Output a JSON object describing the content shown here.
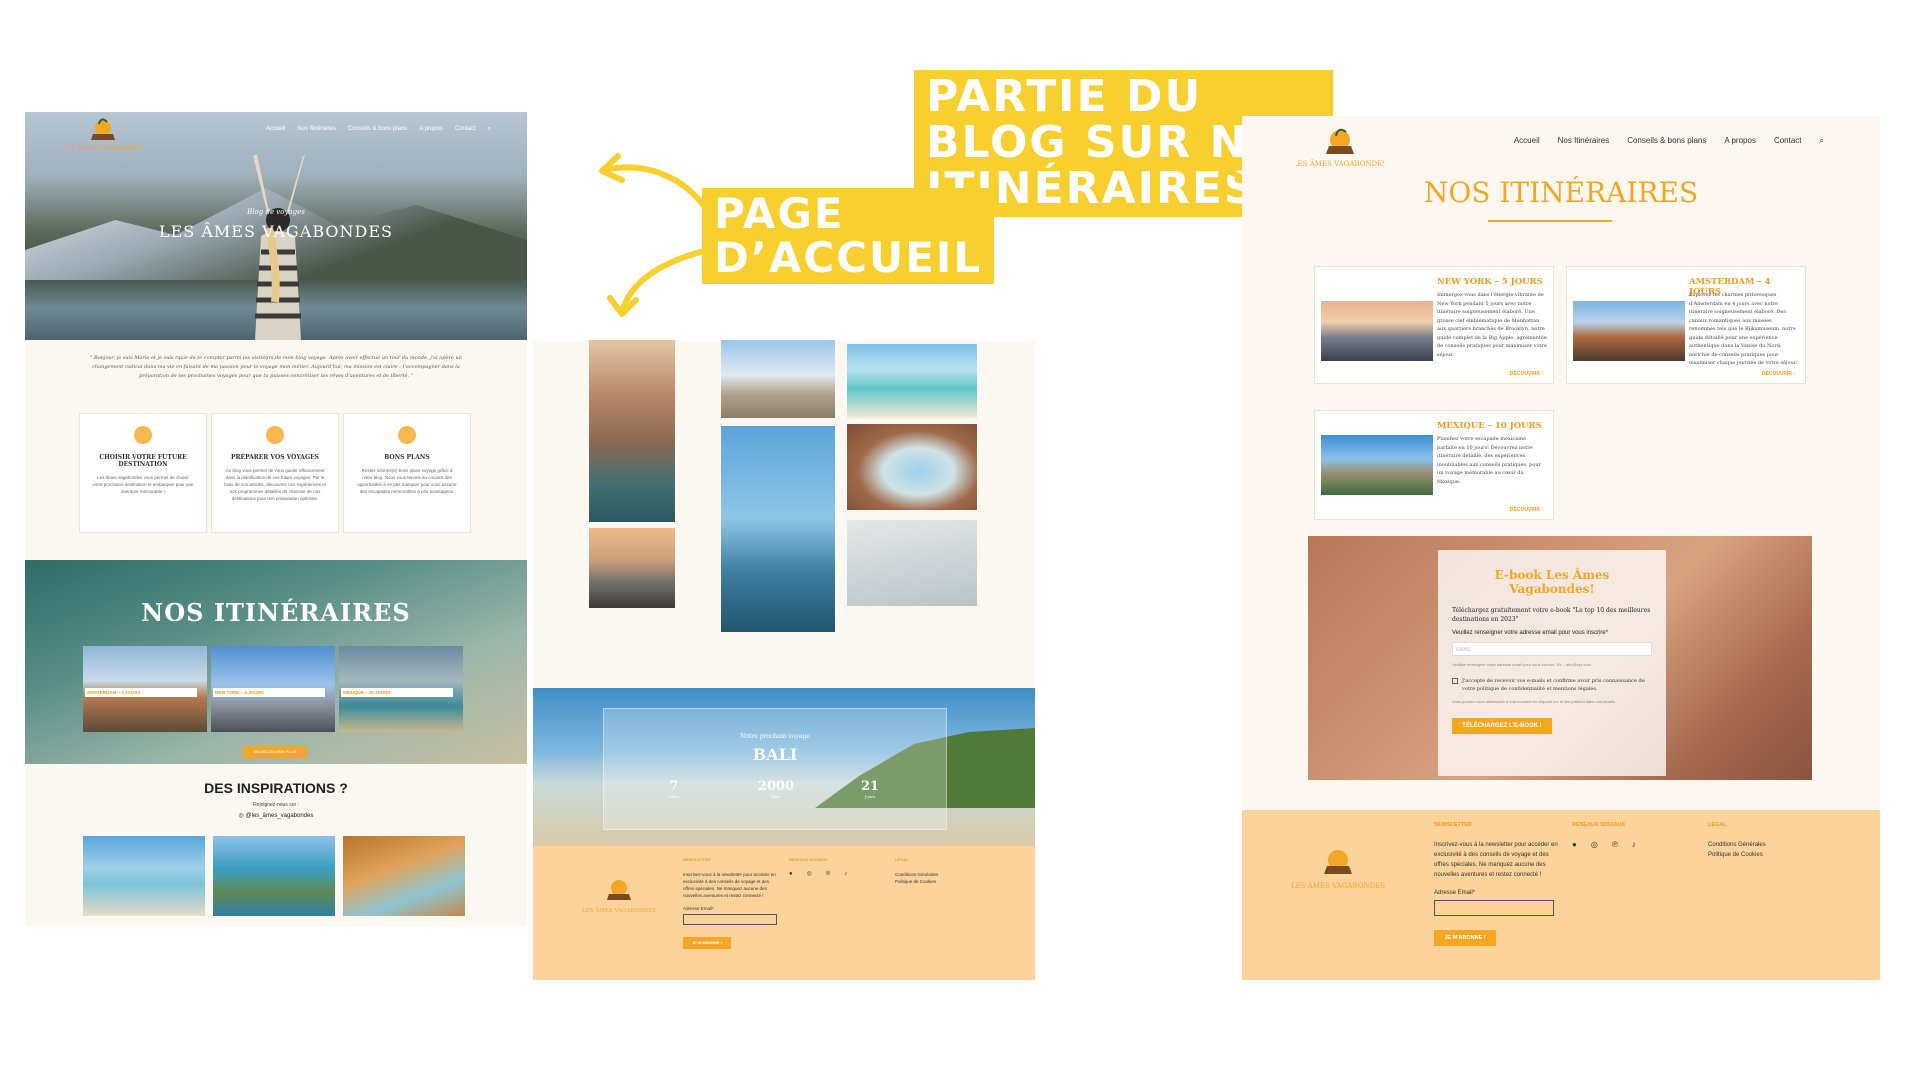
{
  "callouts": {
    "accueil": [
      "PAGE",
      "D’ACCUEIL"
    ],
    "blog": [
      "PARTIE DU",
      "BLOG SUR NOS",
      "ITINÉRAIRES"
    ]
  },
  "colors": {
    "accent": "#f5a623",
    "callout": "#f7cf2f",
    "footer": "#fcd39a"
  },
  "nav": [
    "Accueil",
    "Nos Itinéraires",
    "Conseils & bons plans",
    "A propos",
    "Contact"
  ],
  "nav_icon": "search-icon",
  "logo_text": "LES ÂMES VAGABONDES",
  "home": {
    "hero_subtitle": "Blog de voyages",
    "hero_title": "LES ÂMES VAGABONDES",
    "intro": "\" Bonjour, je suis Marie et je suis ravie de te compter parmi les visiteurs de mon blog voyage. Après avoir effectué un tour du monde, j'ai opéré un changement radical dans ma vie en faisant de ma passion pour le voyage mon métier. Aujourd'hui, ma mission est claire : t'accompagner dans la préparation de tes prochaines voyages pour que tu puisses concrétiser tes rêves d'aventures et de liberté. \"",
    "cards": [
      {
        "title": "CHOISIR VOTRE FUTURE DESTINATION",
        "text": "Les âmes vagabondes vous permet de choisir votre prochaine destination et embarquer pour une aventure mémorable !"
      },
      {
        "title": "PRÉPARER VOS VOYAGES",
        "text": "Ce blog vous permet de vous guider efficacement dans la planification de vos futurs voyages. Par le biais de nos articles, découvrez nos expériences et nos programmes détaillés de chacune de nos destinations pour une préparation optimale."
      },
      {
        "title": "BONS PLANS",
        "text": "Restez informé(e) bons plans voyage grâce à notre blog. Nous vous tenons au courant des opportunités à ne pas manquer pour vous assurer des escapades mémorables à prix avantageux."
      }
    ],
    "itin_title": "NOS ITINÉRAIRES",
    "itin_tags": [
      "AMSTERDAM – 4 JOURS",
      "NEW YORK – 5 JOURS",
      "MEXIQUE – 10 JOURS"
    ],
    "itin_button": "EN DÉCOUVRIR PLUS",
    "insp_title": "DES INSPIRATIONS ?",
    "insp_sub": "Rejoignez-nous sur :",
    "insp_handle": "@les_âmes_vagabondes"
  },
  "bali": {
    "label": "Notre prochain voyage",
    "name": "BALI",
    "stats": [
      {
        "value": "7",
        "unit": "Villes"
      },
      {
        "value": "2000",
        "unit": "Kms"
      },
      {
        "value": "21",
        "unit": "Jours"
      }
    ]
  },
  "footer": {
    "newsletter_title": "NEWSLETTER",
    "newsletter_text": "Inscrivez-vous à la newsletter pour accéder en exclusivité à des conseils de voyage et des offres spéciales. Ne manquez aucune des nouvelles aventures et restez connecté !",
    "email_label": "Adresse Email*",
    "subscribe_button": "JE M'ABONNE !",
    "social_title": "RÉSEAUX SOCIAUX",
    "social_icons": [
      "facebook-icon",
      "instagram-icon",
      "pinterest-icon",
      "tiktok-icon"
    ],
    "legal_title": "LÉGAL",
    "legal_links": [
      "Conditions Générales",
      "Politique de Cookies"
    ]
  },
  "blog": {
    "title": "NOS ITINÉRAIRES",
    "cards": [
      {
        "title": "NEW YORK – 5 JOURS",
        "text": "Immergez-vous dans l'énergie vibrante de New York pendant 5 jours avec notre itinéraire soigneusement élaboré. Une grosse clef emblématique de Manhattan aux quartiers branchés de Brooklyn, notre guide complet de la Big Apple, agrémentée de conseils pratiques pour maximiser votre séjour.",
        "link": "DÉCOUVRIR"
      },
      {
        "title": "AMSTERDAM – 4 JOURS",
        "text": "Explorez les charmes pittoresques d'Amsterdam en 4 jours avec notre itinéraire soigneusement élaboré. Des canaux romantiques aux musées renommés tels que le Rijksmuseum, notre guide détaillé pour une expérience authentique dans la Venise du Nord, enrichie de conseils pratiques pour maximiser chaque journée de votre séjour.",
        "link": "DÉCOUVRIR"
      },
      {
        "title": "MEXIQUE – 10 JOURS",
        "text": "Planifiez votre escapade mexicaine parfaite en 10 jours! Découvrez notre itinéraire détaillé, des expériences inoubliables aux conseils pratiques, pour un voyage mémorable au cœur du Mexique.",
        "link": "DÉCOUVRIR"
      }
    ],
    "ebook": {
      "title": "E-book Les Âmes Vagabondes!",
      "text": "Téléchargez gratuitement votre e-book \"Le top 10 des meilleures destinations en 2023\"",
      "question": "Veuillez renseigner votre adresse email pour vous inscrire*",
      "placeholder": "EMAIL",
      "note": "Veuillez renseigner votre adresse email pour vous inscrire. Ex. : abc@xyz.com",
      "consent": "J'accepte de recevoir vos e-mails et confirme avoir pris connaissance de votre politique de confidentialité et mentions légales.",
      "unsubscribe": "Vous pouvez vous désinscrire à tout moment en cliquant sur le lien présent dans nos emails.",
      "button": "TÉLÉCHARGEZ L'E-BOOK !"
    }
  }
}
